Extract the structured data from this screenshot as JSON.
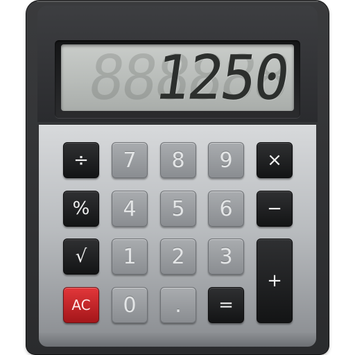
{
  "display": {
    "value": "1250",
    "ghost": "888888"
  },
  "keys": {
    "divide": "÷",
    "seven": "7",
    "eight": "8",
    "nine": "9",
    "multiply": "×",
    "percent": "%",
    "four": "4",
    "five": "5",
    "six": "6",
    "minus": "−",
    "sqrt": "√",
    "one": "1",
    "two": "2",
    "three": "3",
    "plus": "+",
    "clear": "AC",
    "zero": "0",
    "decimal": ".",
    "equals": "="
  },
  "colors": {
    "body": "#2a2b2d",
    "panel": "#b9bcbf",
    "lcd": "#b8bcb9",
    "clear_key": "#c7262a"
  }
}
